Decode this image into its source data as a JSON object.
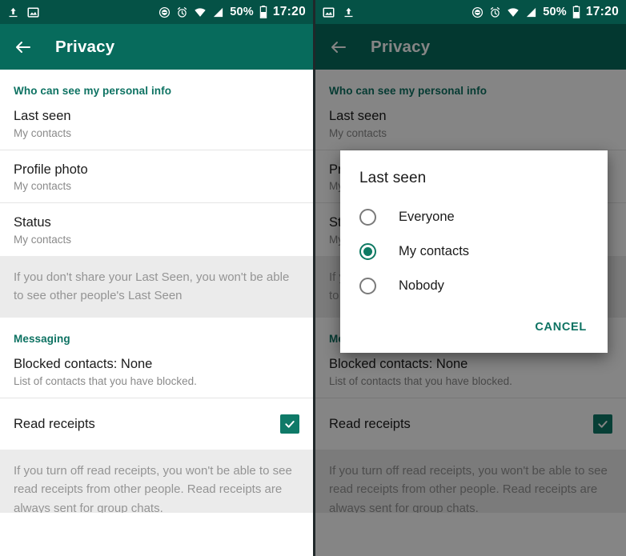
{
  "statusbar": {
    "icons_left_screen1": [
      "upload-icon",
      "image-icon"
    ],
    "icons_left_screen2": [
      "image-icon",
      "upload-icon"
    ],
    "icons_right": [
      "do-not-disturb-icon",
      "alarm-icon",
      "wifi-icon",
      "signal-icon"
    ],
    "battery_percent": "50%",
    "time": "17:20"
  },
  "toolbar": {
    "back_icon": "back-arrow-icon",
    "title": "Privacy"
  },
  "sections": {
    "personal_info_header": "Who can see my personal info",
    "messaging_header": "Messaging"
  },
  "rows": {
    "last_seen": {
      "primary": "Last seen",
      "secondary": "My contacts"
    },
    "profile_photo": {
      "primary": "Profile photo",
      "secondary": "My contacts"
    },
    "status": {
      "primary": "Status",
      "secondary": "My contacts"
    },
    "blocked": {
      "primary": "Blocked contacts: None",
      "secondary": "List of contacts that you have blocked."
    },
    "read_receipts": {
      "primary": "Read receipts",
      "checkbox_icon": "checkmark-icon",
      "checked": true
    }
  },
  "notes": {
    "last_seen_note": "If you don't share your Last Seen, you won't be able to see other people's Last Seen",
    "read_receipts_note": "If you turn off read receipts, you won't be able to see read receipts from other people. Read receipts are always sent for group chats."
  },
  "dialog": {
    "title": "Last seen",
    "options": [
      {
        "label": "Everyone",
        "selected": false
      },
      {
        "label": "My contacts",
        "selected": true
      },
      {
        "label": "Nobody",
        "selected": false
      }
    ],
    "cancel_label": "CANCEL"
  },
  "colors": {
    "statusbar": "#055246",
    "toolbar": "#076B5C",
    "accent": "#0d7262",
    "checkbox": "#0f7a68",
    "note_bg": "#ebebeb"
  }
}
